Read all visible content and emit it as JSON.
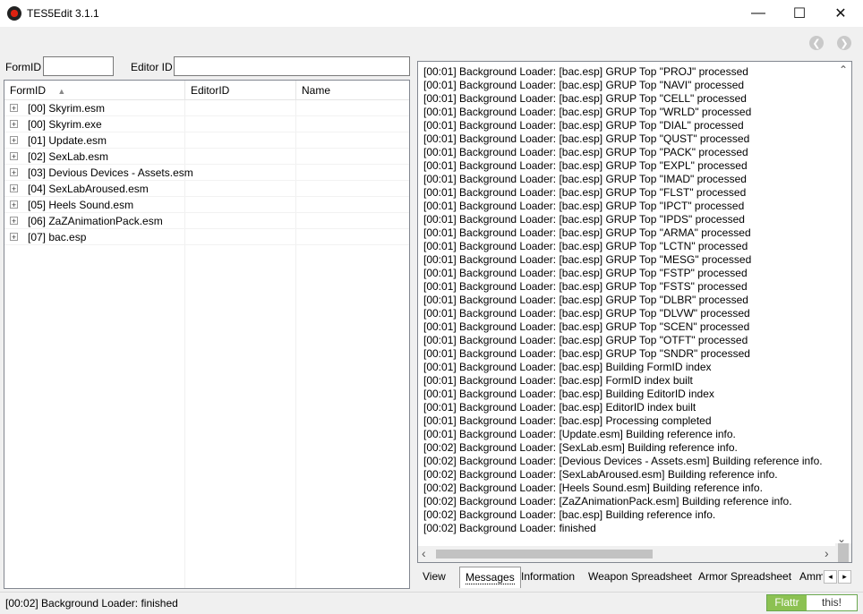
{
  "window": {
    "title": "TES5Edit 3.1.1",
    "minimize_glyph": "—",
    "maximize_glyph": "☐",
    "close_glyph": "✕"
  },
  "nav": {
    "back_glyph": "❮",
    "forward_glyph": "❯"
  },
  "filter": {
    "formid_label": "FormID",
    "formid_value": "",
    "editorid_label": "Editor ID",
    "editorid_value": ""
  },
  "tree": {
    "columns": [
      "FormID",
      "EditorID",
      "Name"
    ],
    "sort_glyph": "▲",
    "expander_glyph": "+",
    "rows": [
      "[00] Skyrim.esm",
      "[00] Skyrim.exe",
      "[01] Update.esm",
      "[02] SexLab.esm",
      "[03] Devious Devices - Assets.esm",
      "[04] SexLabAroused.esm",
      "[05] Heels Sound.esm",
      "[06] ZaZAnimationPack.esm",
      "[07] bac.esp"
    ]
  },
  "log": {
    "lines": [
      "[00:01] Background Loader: [bac.esp] GRUP Top \"PROJ\" processed",
      "[00:01] Background Loader: [bac.esp] GRUP Top \"NAVI\" processed",
      "[00:01] Background Loader: [bac.esp] GRUP Top \"CELL\" processed",
      "[00:01] Background Loader: [bac.esp] GRUP Top \"WRLD\" processed",
      "[00:01] Background Loader: [bac.esp] GRUP Top \"DIAL\" processed",
      "[00:01] Background Loader: [bac.esp] GRUP Top \"QUST\" processed",
      "[00:01] Background Loader: [bac.esp] GRUP Top \"PACK\" processed",
      "[00:01] Background Loader: [bac.esp] GRUP Top \"EXPL\" processed",
      "[00:01] Background Loader: [bac.esp] GRUP Top \"IMAD\" processed",
      "[00:01] Background Loader: [bac.esp] GRUP Top \"FLST\" processed",
      "[00:01] Background Loader: [bac.esp] GRUP Top \"IPCT\" processed",
      "[00:01] Background Loader: [bac.esp] GRUP Top \"IPDS\" processed",
      "[00:01] Background Loader: [bac.esp] GRUP Top \"ARMA\" processed",
      "[00:01] Background Loader: [bac.esp] GRUP Top \"LCTN\" processed",
      "[00:01] Background Loader: [bac.esp] GRUP Top \"MESG\" processed",
      "[00:01] Background Loader: [bac.esp] GRUP Top \"FSTP\" processed",
      "[00:01] Background Loader: [bac.esp] GRUP Top \"FSTS\" processed",
      "[00:01] Background Loader: [bac.esp] GRUP Top \"DLBR\" processed",
      "[00:01] Background Loader: [bac.esp] GRUP Top \"DLVW\" processed",
      "[00:01] Background Loader: [bac.esp] GRUP Top \"SCEN\" processed",
      "[00:01] Background Loader: [bac.esp] GRUP Top \"OTFT\" processed",
      "[00:01] Background Loader: [bac.esp] GRUP Top \"SNDR\" processed",
      "[00:01] Background Loader: [bac.esp] Building FormID index",
      "[00:01] Background Loader: [bac.esp] FormID index built",
      "[00:01] Background Loader: [bac.esp] Building EditorID index",
      "[00:01] Background Loader: [bac.esp] EditorID index built",
      "[00:01] Background Loader: [bac.esp] Processing completed",
      "[00:01] Background Loader: [Update.esm] Building reference info.",
      "[00:02] Background Loader: [SexLab.esm] Building reference info.",
      "[00:02] Background Loader: [Devious Devices - Assets.esm] Building reference info.",
      "[00:02] Background Loader: [SexLabAroused.esm] Building reference info.",
      "[00:02] Background Loader: [Heels Sound.esm] Building reference info.",
      "[00:02] Background Loader: [ZaZAnimationPack.esm] Building reference info.",
      "[00:02] Background Loader: [bac.esp] Building reference info.",
      "[00:02] Background Loader: finished"
    ],
    "scroll_up_glyph": "⌃",
    "scroll_down_glyph": "⌄",
    "scroll_left_glyph": "‹",
    "scroll_right_glyph": "›"
  },
  "tabs": [
    "View",
    "Messages",
    "Information",
    "Weapon Spreadsheet",
    "Armor Spreadsheet",
    "Amm"
  ],
  "tab_prev_glyph": "◂",
  "tab_next_glyph": "▸",
  "status": {
    "text": "[00:02] Background Loader: finished"
  },
  "flattr": {
    "label": "Flattr",
    "this": "this!"
  },
  "colors": {
    "flattr_green": "#8cc152",
    "accent": "#0078d7"
  }
}
